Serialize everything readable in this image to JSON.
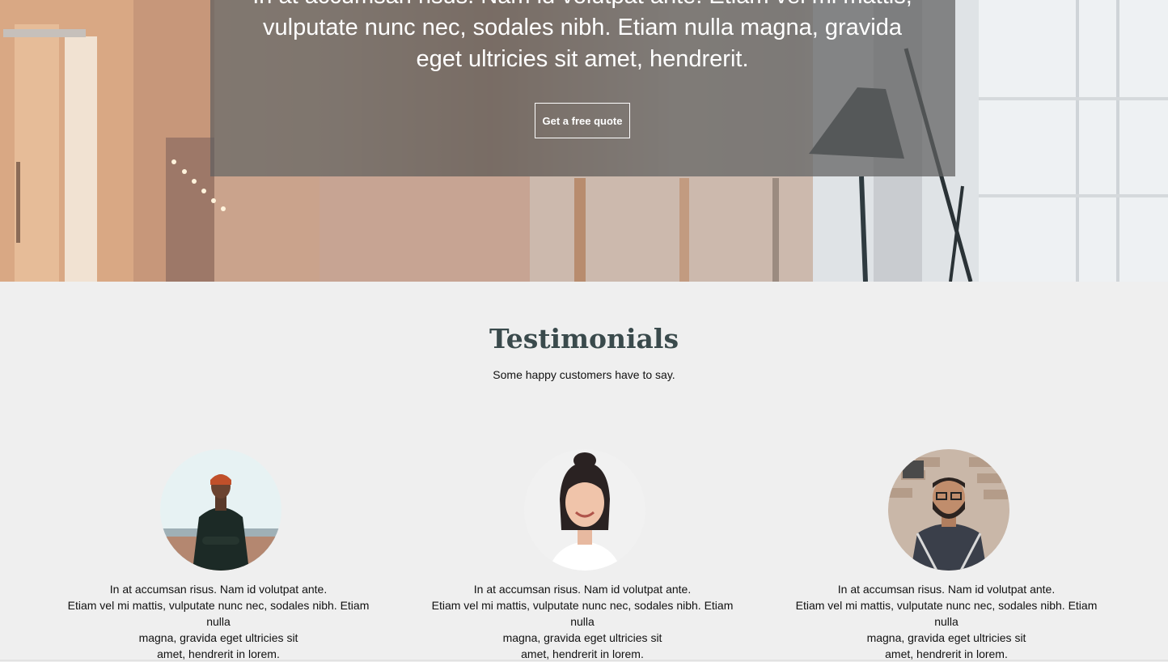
{
  "hero": {
    "text_line1": "In at accumsan risus. Nam id volutpat ante. Etiam vel mi mattis,",
    "text_line2": "vulputate nunc nec, sodales nibh. Etiam nulla magna, gravida",
    "text_line3": "eget ultricies sit amet, hendrerit.",
    "cta_label": "Get a free quote"
  },
  "testimonials": {
    "title": "Testimonials",
    "subtitle": "Some happy customers have to say.",
    "items": [
      {
        "line1": "In at accumsan risus. Nam id volutpat ante.",
        "line2": "Etiam vel mi mattis, vulputate nunc nec, sodales nibh. Etiam nulla",
        "line3": "magna, gravida eget ultricies sit",
        "line4": "amet, hendrerit in lorem."
      },
      {
        "line1": "In at accumsan risus. Nam id volutpat ante.",
        "line2": "Etiam vel mi mattis, vulputate nunc nec, sodales nibh. Etiam nulla",
        "line3": "magna, gravida eget ultricies sit",
        "line4": "amet, hendrerit in lorem."
      },
      {
        "line1": "In at accumsan risus. Nam id volutpat ante.",
        "line2": "Etiam vel mi mattis, vulputate nunc nec, sodales nibh. Etiam nulla",
        "line3": "magna, gravida eget ultricies sit",
        "line4": "amet, hendrerit in lorem."
      }
    ]
  },
  "colors": {
    "section_bg": "#efefef",
    "title_color": "#3a4a4c",
    "overlay": "#5f5f5f"
  }
}
